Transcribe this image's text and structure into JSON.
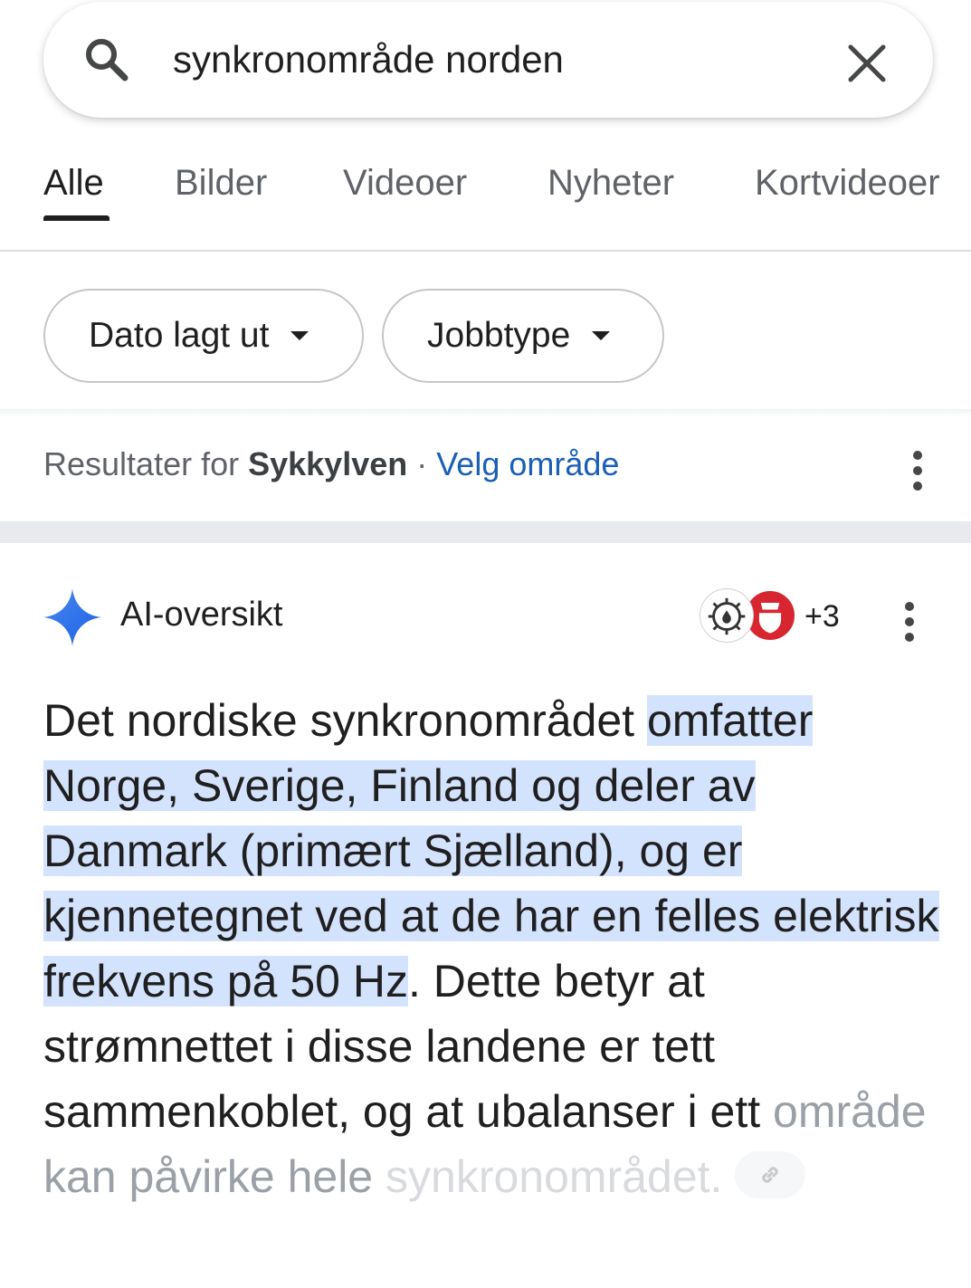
{
  "search": {
    "query": "synkronområde norden"
  },
  "tabs": [
    {
      "label": "Alle",
      "active": true
    },
    {
      "label": "Bilder"
    },
    {
      "label": "Videoer"
    },
    {
      "label": "Nyheter"
    },
    {
      "label": "Kortvideoer"
    }
  ],
  "chips": [
    {
      "label": "Dato lagt ut"
    },
    {
      "label": "Jobbtype"
    }
  ],
  "location": {
    "prefix": "Resultater for",
    "place": "Sykkylven",
    "separator": "·",
    "link": "Velg område"
  },
  "ai_overview": {
    "title": "AI-oversikt",
    "sources_more": "+3",
    "text_intro": "Det nordiske synkronområdet ",
    "text_highlight": "omfatter Norge, Sverige, Finland og deler av Danmark (primært Sjælland), og er kjennetegnet ved at de har en felles elektrisk frekvens på 50 Hz",
    "text_rest": ". Dette betyr at strømnettet i disse landene er tett sammenkoblet, og at ubalanser i ett",
    "text_fade1": "område kan påvirke hele",
    "text_fade2": "synkronområdet."
  },
  "colors": {
    "accent": "#1a5fb4",
    "highlight": "#d3e3fd",
    "ai_star": "#2f6fe8"
  },
  "icons": [
    "search-icon",
    "close-icon",
    "caret-down-icon",
    "more-vert-icon",
    "ai-sparkle-icon",
    "link-icon"
  ]
}
